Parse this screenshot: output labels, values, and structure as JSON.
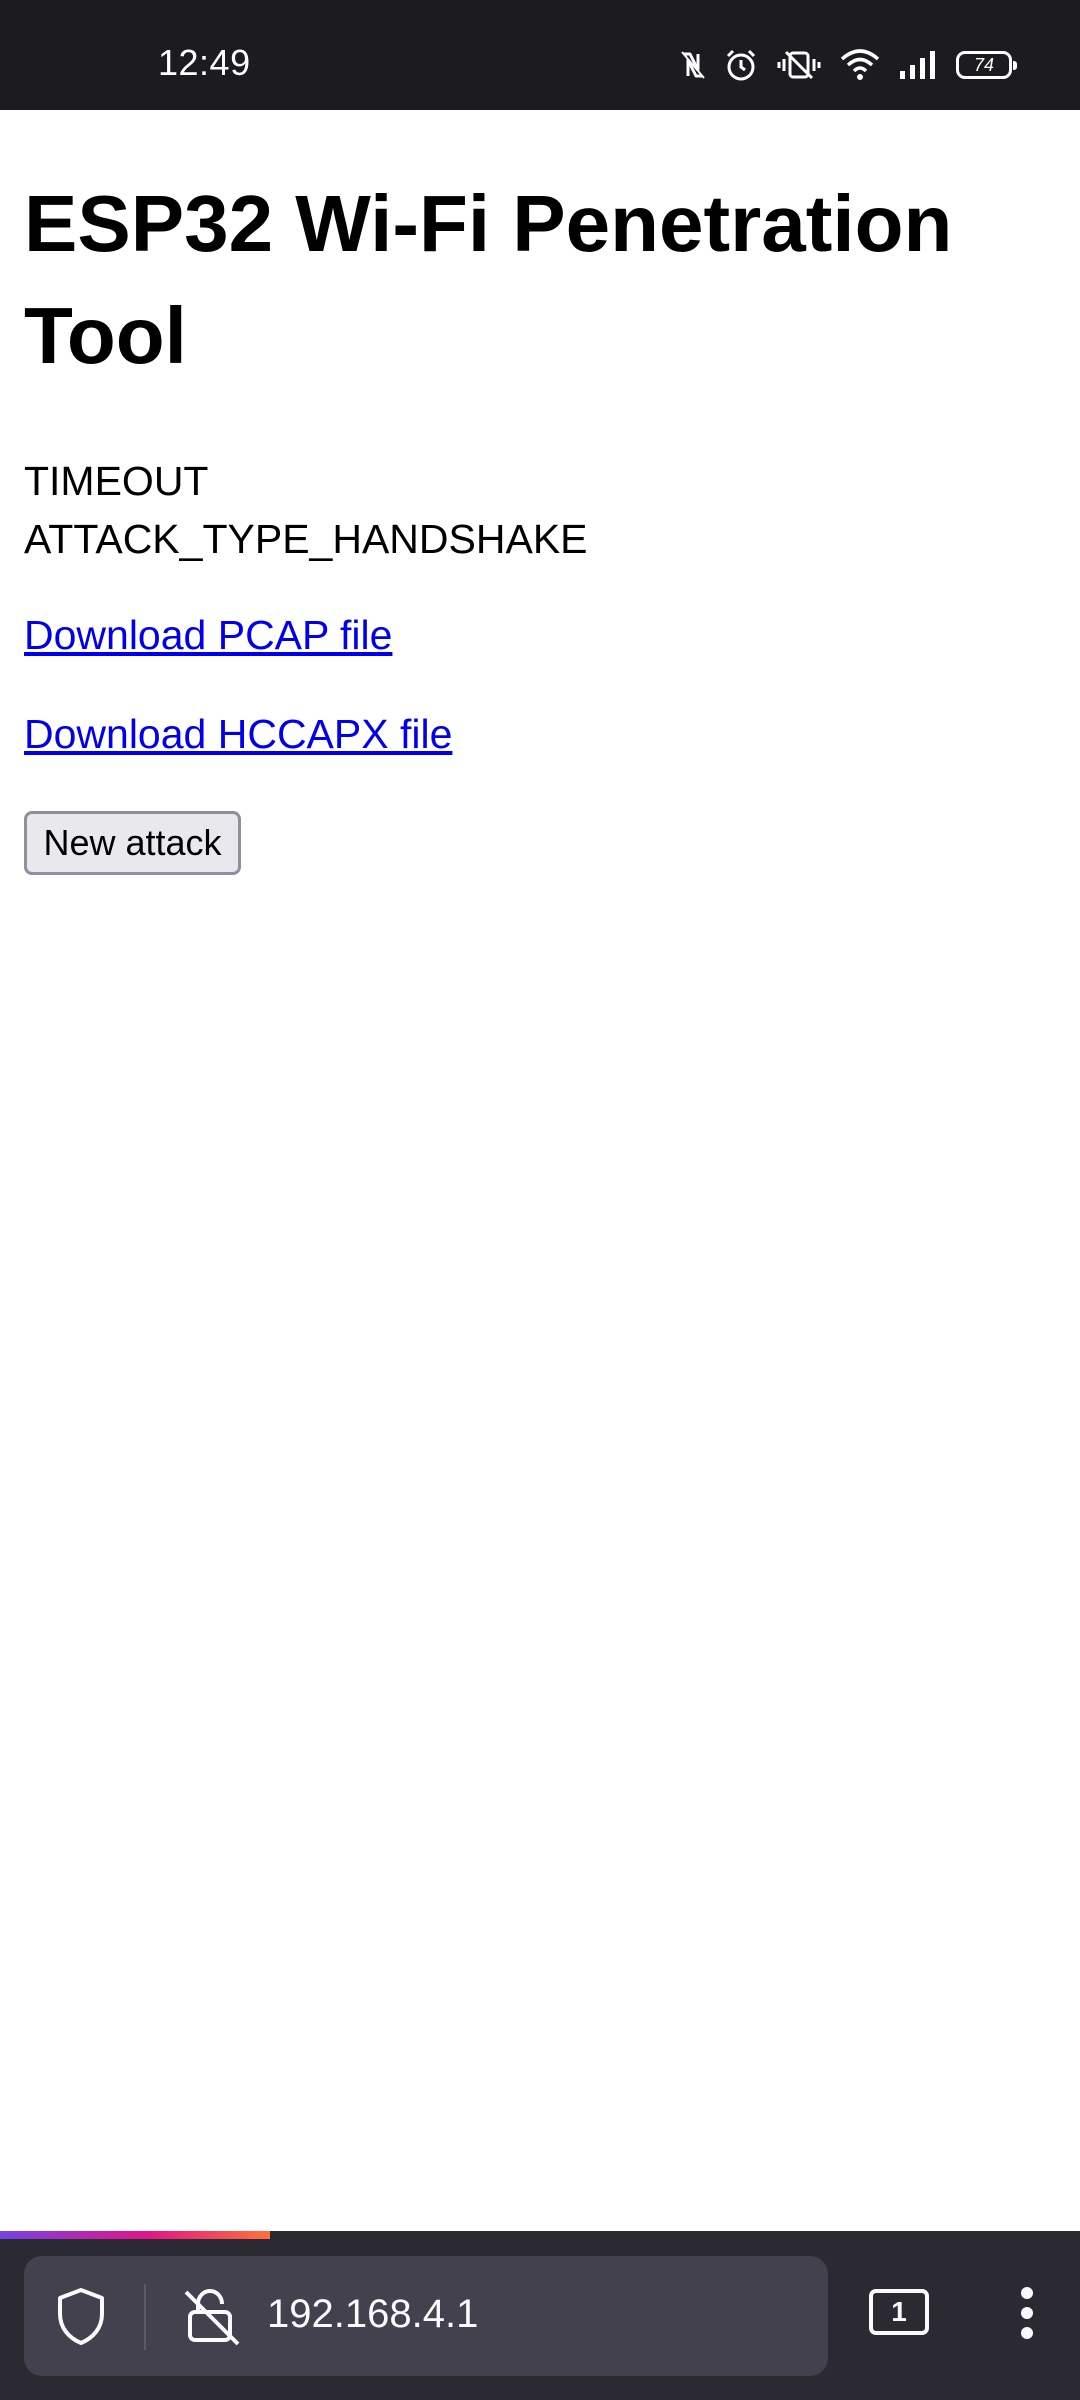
{
  "status_bar": {
    "time": "12:49",
    "battery_level": "74",
    "icons": [
      "nfc-icon",
      "alarm-icon",
      "vibrate-off-icon",
      "wifi-icon",
      "signal-icon",
      "battery-icon"
    ]
  },
  "page": {
    "title": "ESP32 Wi-Fi Penetration Tool",
    "status_lines": [
      "TIMEOUT",
      "ATTACK_TYPE_HANDSHAKE"
    ],
    "links": {
      "pcap": "Download PCAP file",
      "hccapx": "Download HCCAPX file"
    },
    "new_attack_label": "New attack"
  },
  "browser": {
    "url": "192.168.4.1",
    "tab_count": "1",
    "load_progress": 0.25,
    "colors": {
      "toolbar": "#2b2a33",
      "url_bar": "#42414d",
      "link": "#0000ee"
    }
  }
}
